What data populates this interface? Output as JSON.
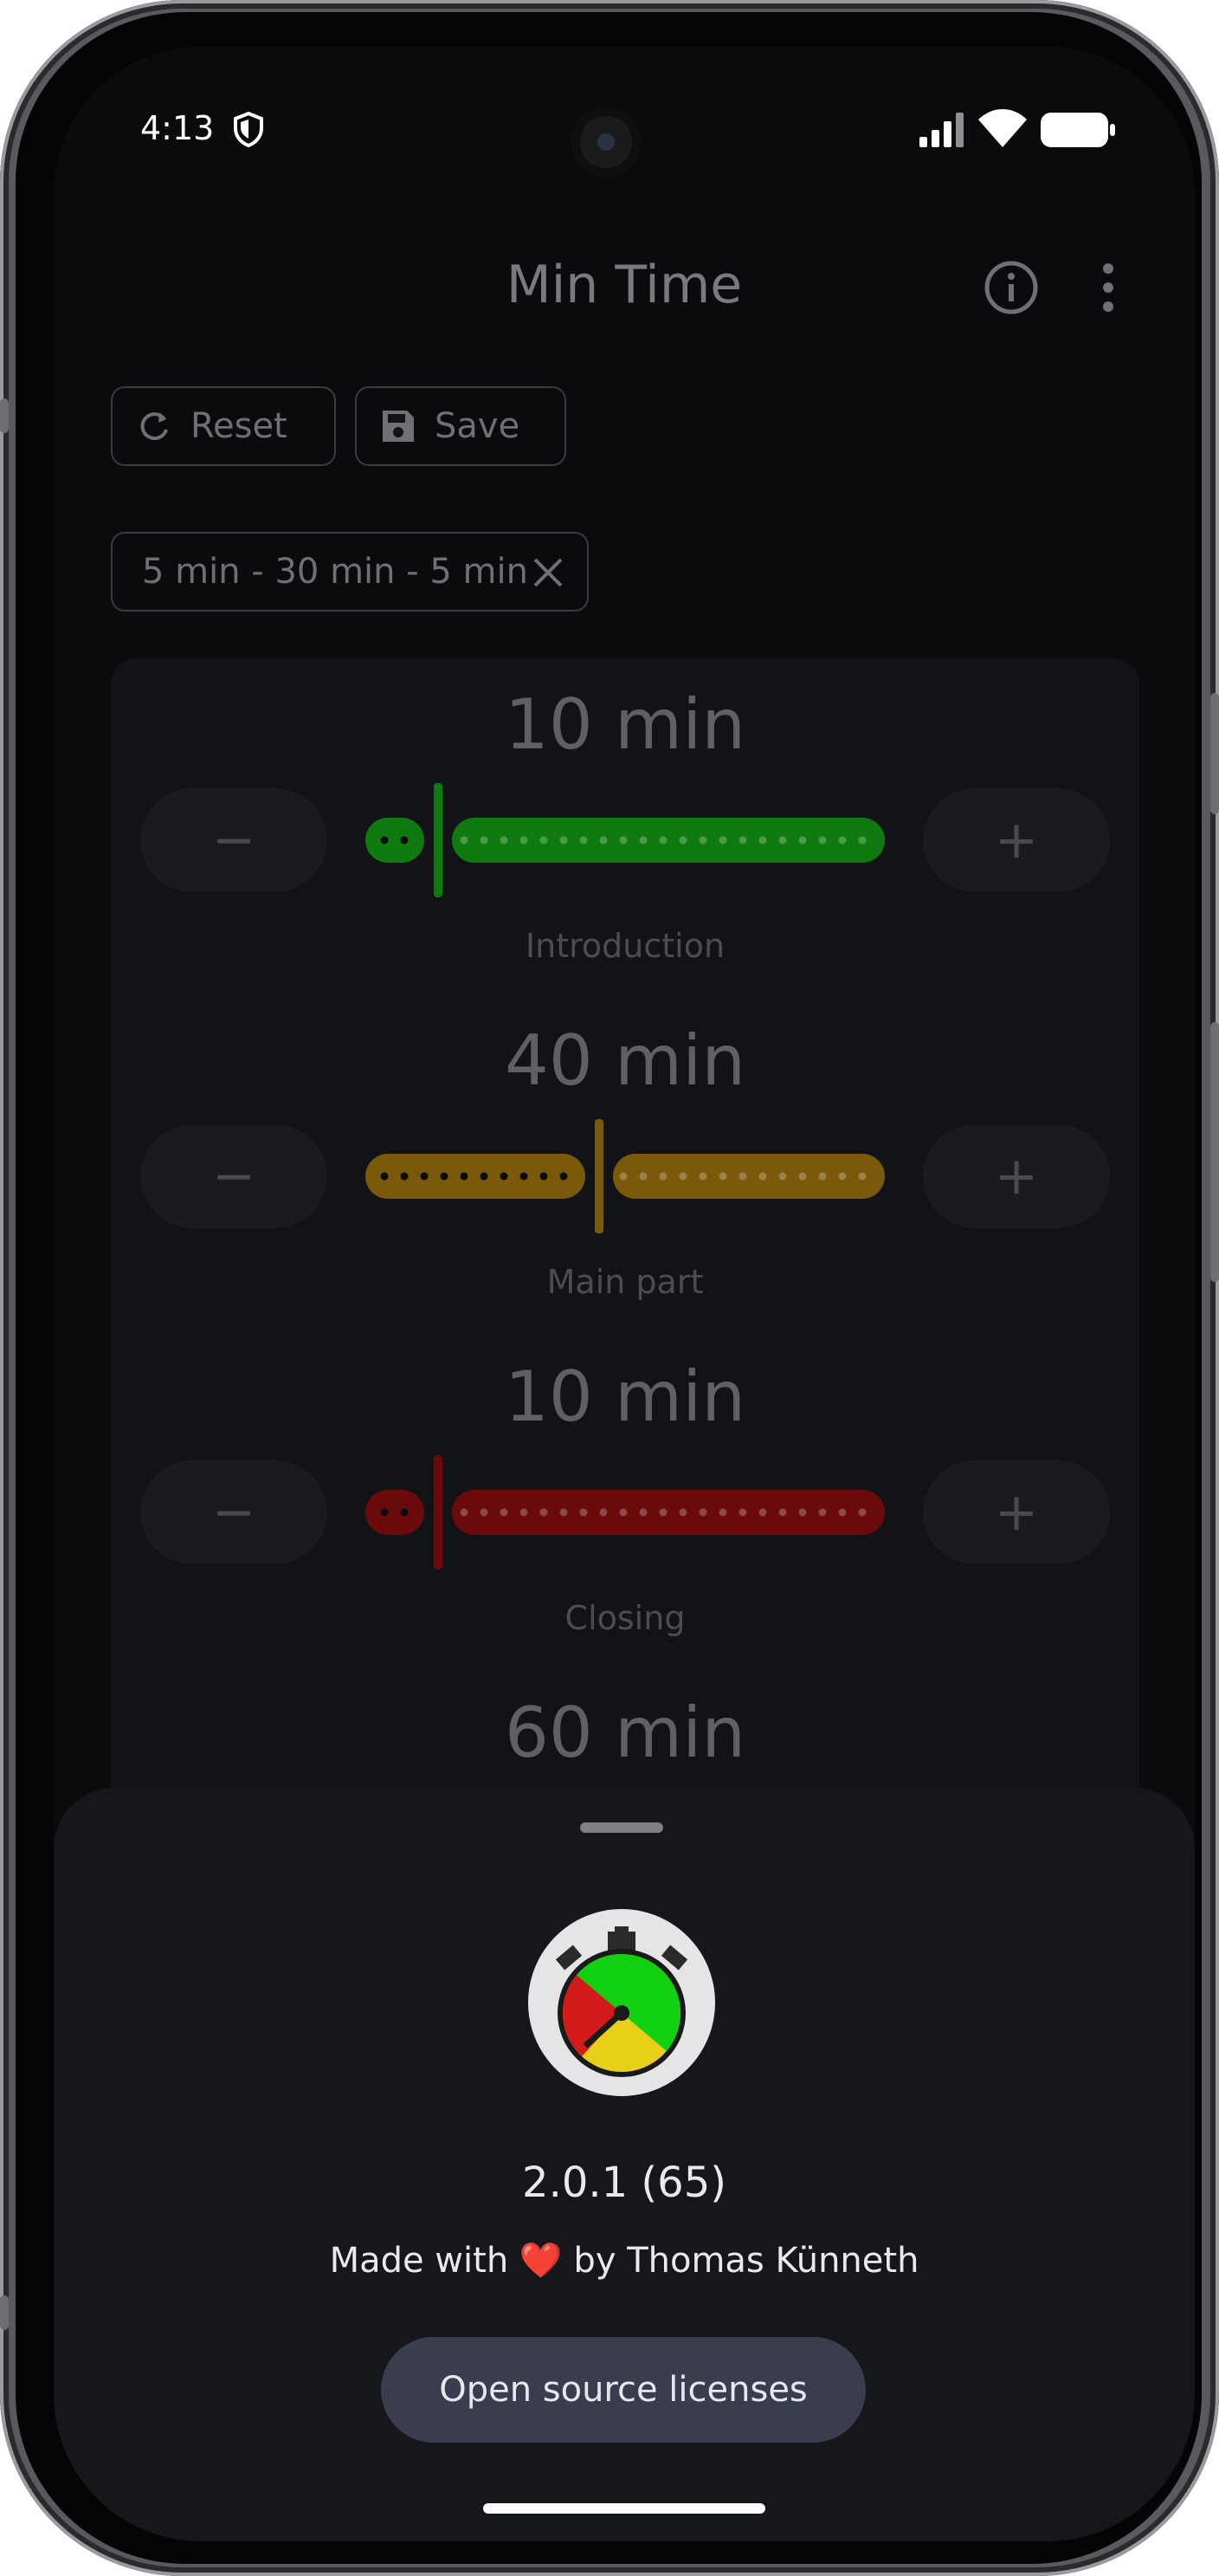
{
  "status": {
    "time": "4:13"
  },
  "appbar": {
    "title": "Min Time"
  },
  "toolbar": {
    "reset_label": "Reset",
    "save_label": "Save"
  },
  "filter_chip": {
    "label": "5 min - 30 min - 5 min"
  },
  "sections": [
    {
      "value": "10 min",
      "label": "Introduction",
      "fraction": 0.14,
      "color": "#0f7a0f"
    },
    {
      "value": "40 min",
      "label": "Main part",
      "fraction": 0.45,
      "color": "#7a5a0a"
    },
    {
      "value": "10 min",
      "label": "Closing",
      "fraction": 0.14,
      "color": "#6a0a0a"
    }
  ],
  "total": {
    "value": "60 min"
  },
  "controls": {
    "minus": "−",
    "plus": "+"
  },
  "about": {
    "version": "2.0.1 (65)",
    "made_prefix": "Made with",
    "heart": "❤️",
    "made_suffix": "by Thomas Künneth",
    "licenses_button": "Open source licenses"
  }
}
